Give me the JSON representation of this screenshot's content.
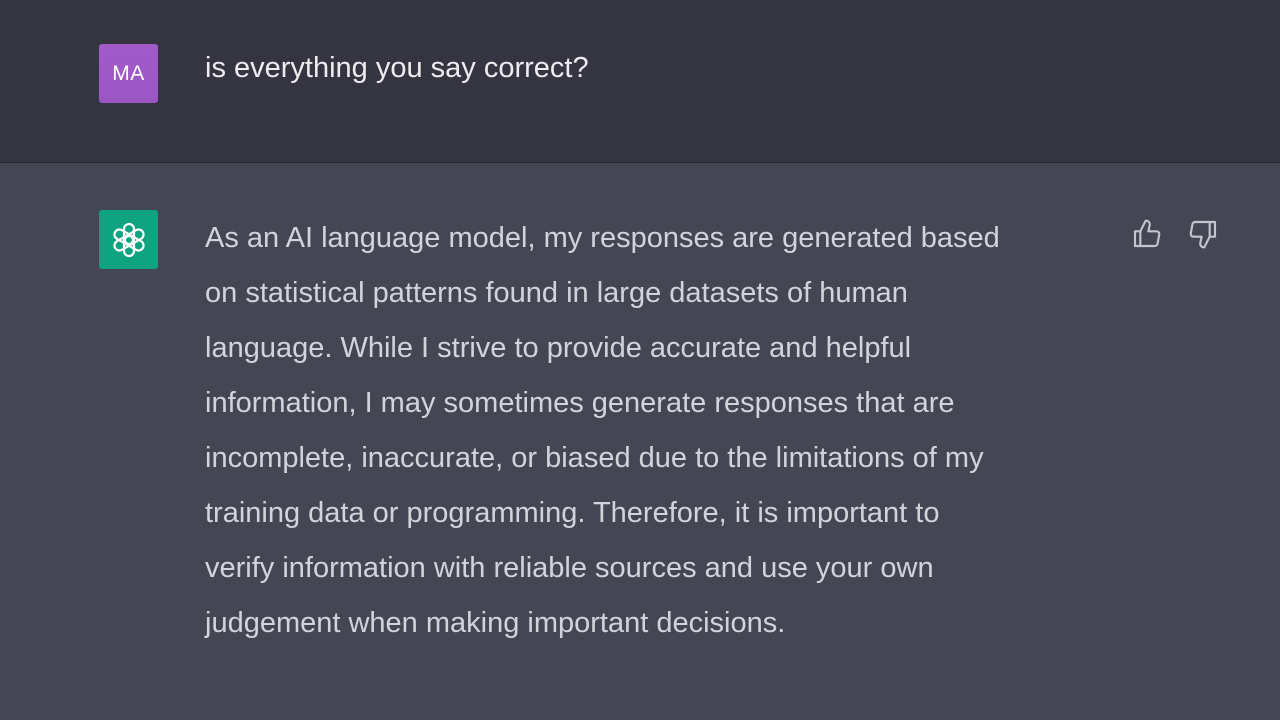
{
  "user": {
    "avatar_initials": "MA",
    "avatar_color": "#9e59c6",
    "message": "is everything you say correct?"
  },
  "assistant": {
    "avatar_icon": "openai-logo-icon",
    "avatar_color": "#10a37f",
    "lines": [
      "As an AI language model, my responses are generated based",
      "on statistical patterns found in large datasets of human",
      "language. While I strive to provide accurate and helpful",
      "information, I may sometimes generate responses that are",
      "incomplete, inaccurate, or biased due to the limitations of my",
      "training data or programming. Therefore, it is important to",
      "verify information with reliable sources and use your own",
      "judgement when making important decisions."
    ],
    "feedback": {
      "like_icon": "thumbs-up-icon",
      "dislike_icon": "thumbs-down-icon"
    }
  },
  "colors": {
    "user_row_bg": "#343541",
    "assistant_row_bg": "#444654",
    "user_text": "#ececf1",
    "assistant_text": "#d1d5db"
  }
}
